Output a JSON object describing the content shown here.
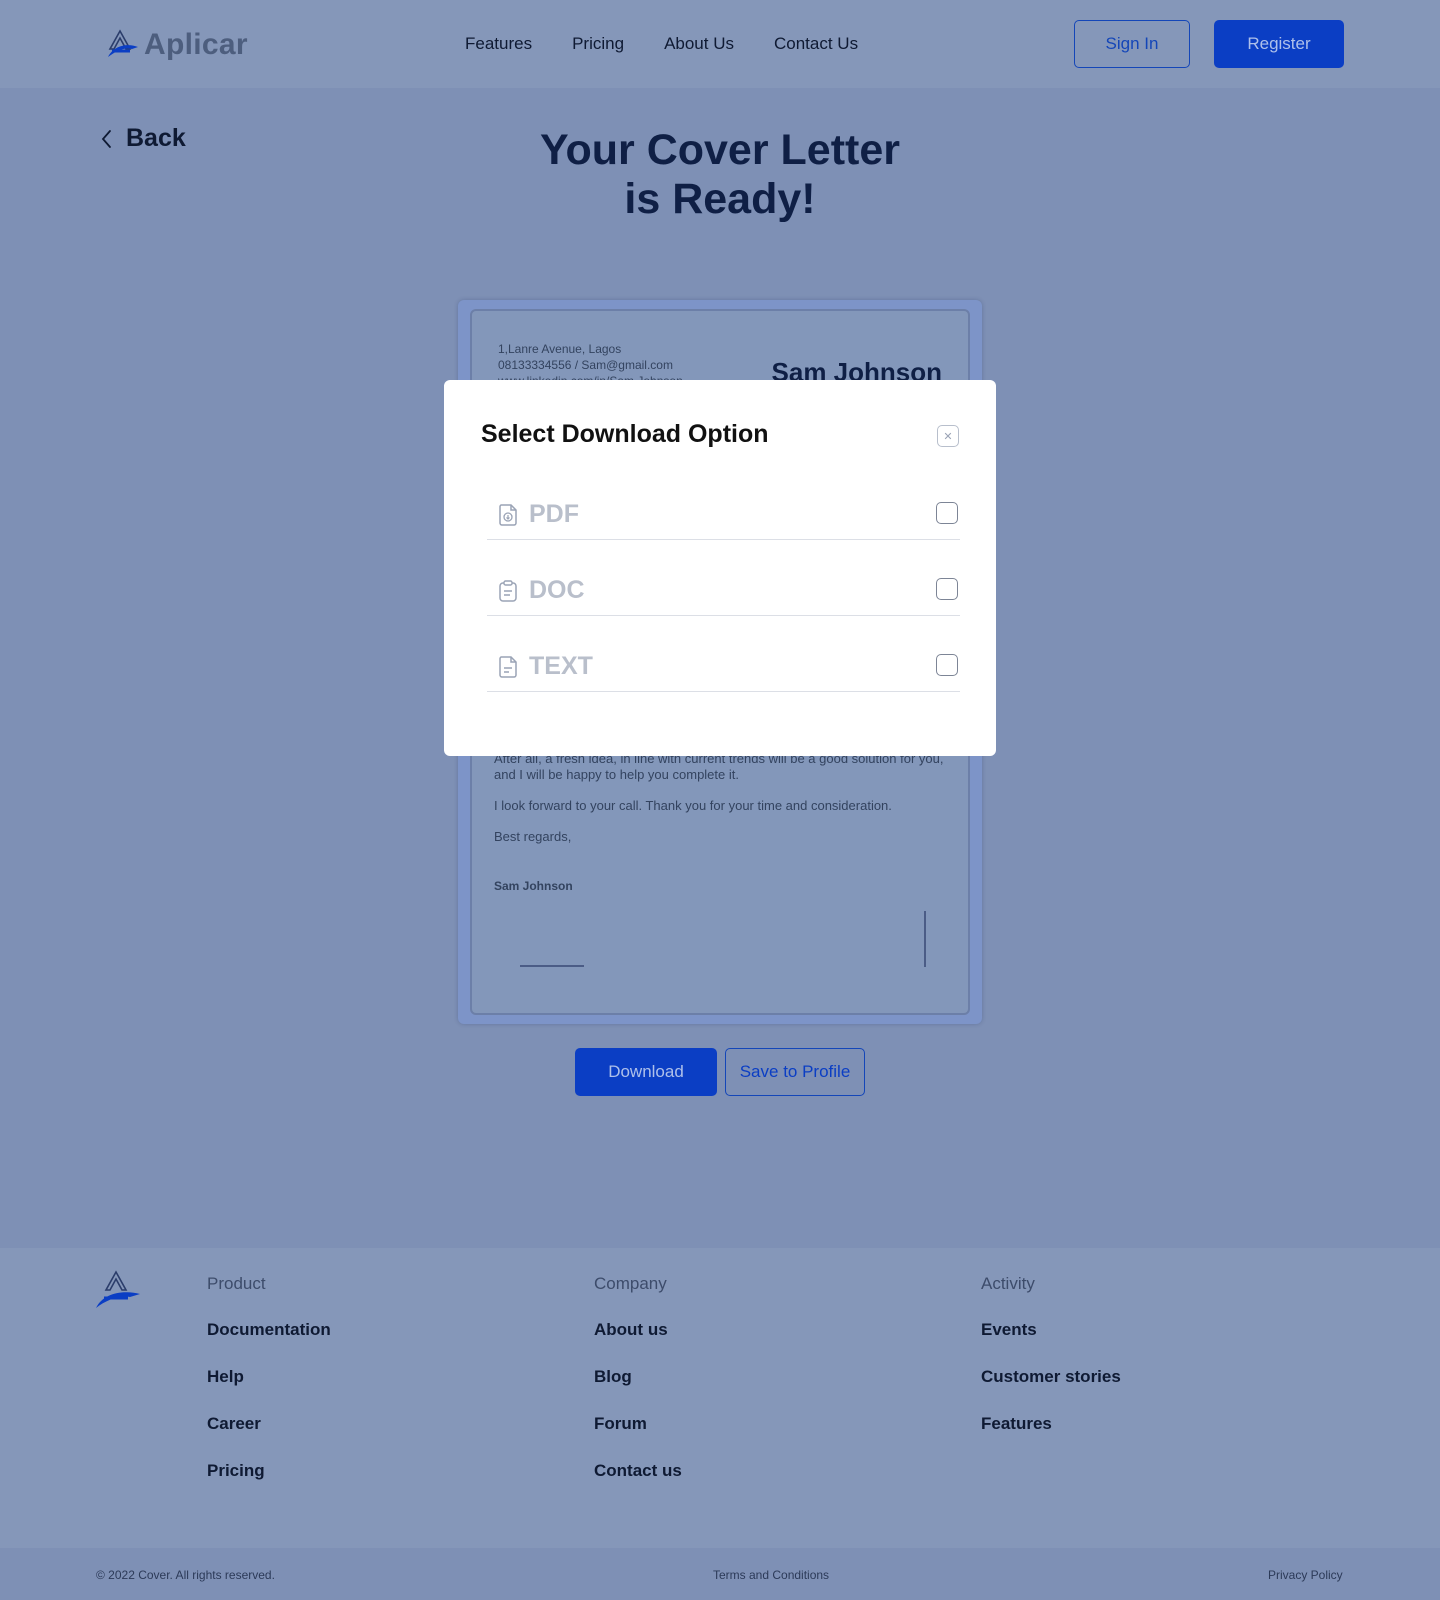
{
  "header": {
    "logo_text": "Aplicar",
    "nav": [
      "Features",
      "Pricing",
      "About Us",
      "Contact Us"
    ],
    "sign_in": "Sign In",
    "register": "Register"
  },
  "page": {
    "back_label": "Back",
    "title_line1": "Your Cover Letter",
    "title_line2": "is Ready!"
  },
  "letter": {
    "address_lines": [
      "1,Lanre Avenue, Lagos",
      "08133334556 / Sam@gmail.com",
      "www.linkedin.com/in/Sam Johnson"
    ],
    "name": "Sam Johnson",
    "paragraphs": [
      "After all, a fresh idea, in line with current trends will be a good solution for you, and I will be happy to help you complete it.",
      "I look forward to your call. Thank you for your time and consideration.",
      "Best regards,"
    ],
    "signature_name": "Sam Johnson"
  },
  "actions": {
    "download": "Download",
    "save": "Save to Profile"
  },
  "modal": {
    "title": "Select Download Option",
    "close_glyph": "✕",
    "options": [
      {
        "label": "PDF",
        "icon": "pdf-file-icon"
      },
      {
        "label": "DOC",
        "icon": "clipboard-icon"
      },
      {
        "label": "TEXT",
        "icon": "text-file-icon"
      }
    ]
  },
  "footer": {
    "columns": [
      {
        "heading": "Product",
        "links": [
          "Documentation",
          "Help",
          "Career",
          "Pricing"
        ]
      },
      {
        "heading": "Company",
        "links": [
          "About us",
          "Blog",
          "Forum",
          "Contact us"
        ]
      },
      {
        "heading": "Activity",
        "links": [
          "Events",
          "Customer stories",
          "Features"
        ]
      }
    ],
    "copyright": "© 2022 Cover. All rights reserved.",
    "terms": "Terms and Conditions",
    "privacy": "Privacy Policy"
  },
  "colors": {
    "overlay_bg": "#7e90b5",
    "accent": "#0b3ec4",
    "modal_bg": "#ffffff"
  }
}
